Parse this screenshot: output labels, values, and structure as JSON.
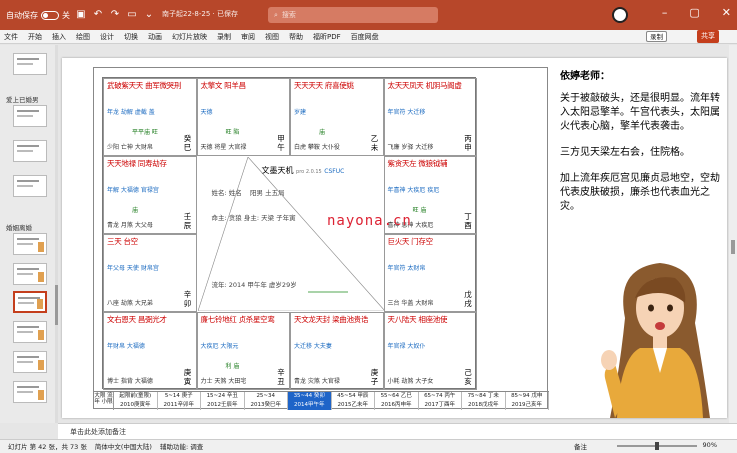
{
  "app": {
    "autosave_label": "自动保存",
    "autosave_state": "关",
    "doc_title": "南子起22-8-25 · 已保存",
    "search_placeholder": "搜索"
  },
  "ribbon": {
    "tabs": [
      "文件",
      "开始",
      "插入",
      "绘图",
      "设计",
      "切换",
      "动画",
      "幻灯片放映",
      "录制",
      "审阅",
      "视图",
      "帮助",
      "福昕PDF",
      "百度网盘"
    ],
    "record": "录制",
    "share": "共享"
  },
  "thumbnails": {
    "section1": "爱上已婚男",
    "section2": "婚姻离婚",
    "numbers": [
      "38",
      "39",
      "40",
      "41",
      "42",
      "43"
    ]
  },
  "chart": {
    "title": "文墨天机",
    "version": "pro 2.0.15",
    "brand": "CSFUC",
    "name_line": "姓名: 姓名",
    "yinyang": "阳男 土五局",
    "ming_line": "命主: 贪狼 身主: 天梁 子年寅",
    "liunian": "流年: 2014 甲午年  虚岁29岁",
    "palaces": [
      {
        "top": "武破紫天天 曲军微哭刑",
        "mid": "平平庙  旺",
        "stars2": "年龙 劫解 虚截 盖",
        "gz": "癸巳",
        "bot": "少阳 亡神 大财帛"
      },
      {
        "top": "太擎文 阳羊昌",
        "mid": "旺  陷",
        "stars2": "天德",
        "gz": "甲午",
        "bot": "天德 将星 大官禄"
      },
      {
        "top": "天天天天 府喜使姚",
        "mid": "庙",
        "stars2": "岁建",
        "gz": "乙未",
        "bot": "白虎 攀鞍 大仆役"
      },
      {
        "top": "太天天凤天 机阴马阁虚",
        "mid": "",
        "stars2": "年官符 大迁移",
        "gz": "丙申",
        "bot": "飞廉 岁驿 大迁移"
      },
      {
        "top": "天天地禄 同寿劫存",
        "mid": "庙",
        "stars2": "年解 大福德 官禄宫",
        "gz": "壬辰",
        "bot": "青龙 月煞 大父母"
      },
      {
        "top": "紫贪天左 微狼钺辅",
        "mid": "旺  庙",
        "stars2": "年喜神 大疾厄 疾厄",
        "gz": "丁酉",
        "bot": "喜神 息神 大疾厄"
      },
      {
        "top": "三天 台空",
        "mid": "",
        "stars2": "年父母 天使 财帛宫",
        "gz": "辛卯",
        "bot": "八座 劫煞 大兄弟"
      },
      {
        "top": "巨火天 门存空",
        "mid": "",
        "stars2": "年官符 太财帛",
        "gz": "戊戌",
        "bot": "三台 华盖 大财帛"
      },
      {
        "top": "文右恩天 昌弼光才",
        "mid": "",
        "stars2": "年财帛 大福德",
        "gz": "庚寅",
        "bot": "博士 指背 大福德"
      },
      {
        "top": "廉七铃地红 贞杀星空鸾",
        "mid": "利 庙",
        "stars2": "大疾厄 大限元",
        "gz": "辛丑",
        "bot": "力士 天煞 大田宅"
      },
      {
        "top": "天文龙天封 梁曲池贵诰",
        "mid": "",
        "stars2": "大迁移 大夫妻",
        "gz": "庚子",
        "bot": "青龙 灾煞 大官禄"
      },
      {
        "top": "天八陆天 相座池使",
        "mid": "",
        "stars2": "年官禄 大奴仆",
        "gz": "己亥",
        "bot": "小耗 劫煞 大子女"
      }
    ],
    "timeline_first": "大限 流年 小限",
    "timeline": [
      "起限前(童限)",
      "5~14 庚子",
      "15~24 辛丑",
      "25~34",
      "35~44 癸卯",
      "45~54 甲辰",
      "55~64 乙巳",
      "65~74 丙午",
      "75~84 丁未",
      "85~94 戊申"
    ],
    "timeline_years": [
      "2010庚寅年",
      "2011辛卯年",
      "2012壬辰年",
      "2013癸巳年",
      "2014甲午年",
      "2015乙未年",
      "2016丙申年",
      "2017丁酉年",
      "2018戊戌年",
      "2019己亥年"
    ],
    "selected_index": 4
  },
  "slide_notes": {
    "heading": "依婷老师：",
    "p1": "关于被敲破头，还是很明显。流年转入太阳忌擎羊。午宫代表头，太阳属火代表心脑，擎羊代表袭击。",
    "p2": "三方见天梁左右会，住院格。",
    "p3": "加上流年疾厄宫见廉贞忌地空，空劫代表皮肤破损，廉杀也代表血光之灾。"
  },
  "watermark": "nayona.cn",
  "notes_bar": "单击此处添加备注",
  "status": {
    "slide": "幻灯片 第 42 张，共 73 张",
    "lang": "简体中文(中国大陆)",
    "access": "辅助功能: 调查",
    "notes": "备注",
    "zoom": "90%"
  },
  "colors": {
    "accent": "#b7472a",
    "star_red": "#cc0000",
    "selected_year": "#1e64c8"
  }
}
